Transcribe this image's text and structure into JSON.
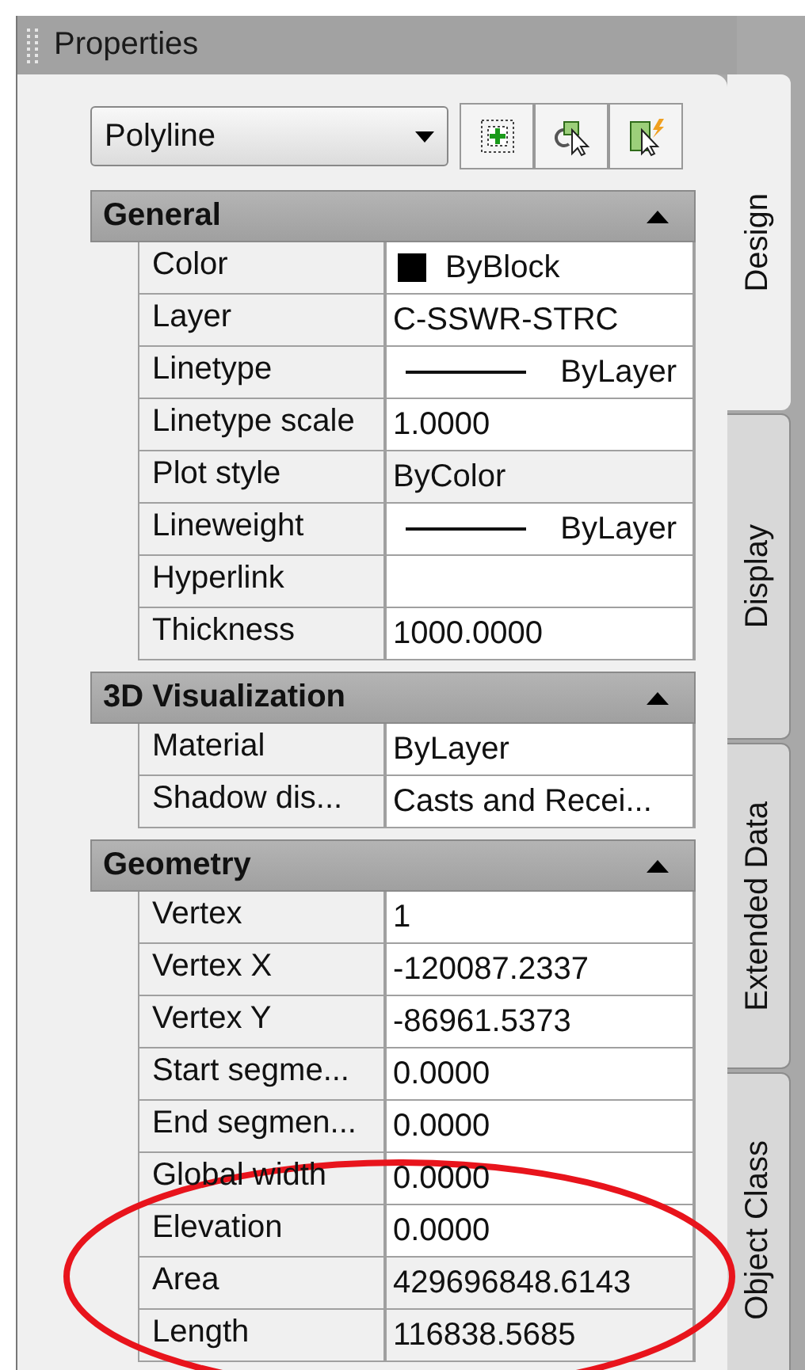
{
  "window": {
    "title": "Properties"
  },
  "object_type": {
    "value": "Polyline"
  },
  "toolbar": [
    {
      "kind": "add"
    },
    {
      "kind": "select"
    },
    {
      "kind": "quick"
    }
  ],
  "sections": [
    {
      "title": "General",
      "expanded": true,
      "rows": [
        {
          "label": "Color",
          "value": "ByBlock",
          "kind": "color",
          "color": "#000000",
          "readonly": false
        },
        {
          "label": "Layer",
          "value": "C-SSWR-STRC",
          "kind": "text",
          "readonly": false
        },
        {
          "label": "Linetype",
          "value": "ByLayer",
          "kind": "line",
          "readonly": false
        },
        {
          "label": "Linetype scale",
          "value": "1.0000",
          "kind": "text",
          "readonly": false
        },
        {
          "label": "Plot style",
          "value": "ByColor",
          "kind": "text",
          "readonly": true
        },
        {
          "label": "Lineweight",
          "value": "ByLayer",
          "kind": "line",
          "readonly": false
        },
        {
          "label": "Hyperlink",
          "kind": "text",
          "readonly": false
        },
        {
          "label": "Thickness",
          "value": "1000.0000",
          "kind": "text",
          "readonly": false
        }
      ]
    },
    {
      "title": "3D Visualization",
      "expanded": true,
      "rows": [
        {
          "label": "Material",
          "value": "ByLayer",
          "kind": "text",
          "readonly": false
        },
        {
          "label": "Shadow dis...",
          "value": "Casts and Recei...",
          "kind": "text",
          "readonly": false
        }
      ]
    },
    {
      "title": "Geometry",
      "expanded": true,
      "rows": [
        {
          "label": "Vertex",
          "value": "1",
          "kind": "text",
          "readonly": false
        },
        {
          "label": "Vertex X",
          "value": "-120087.2337",
          "kind": "text",
          "readonly": false
        },
        {
          "label": "Vertex Y",
          "value": "-86961.5373",
          "kind": "text",
          "readonly": false
        },
        {
          "label": "Start segme...",
          "value": "0.0000",
          "kind": "text",
          "readonly": false
        },
        {
          "label": "End segmen...",
          "value": "0.0000",
          "kind": "text",
          "readonly": false
        },
        {
          "label": "Global width",
          "value": "0.0000",
          "kind": "text",
          "readonly": false
        },
        {
          "label": "Elevation",
          "value": "0.0000",
          "kind": "text",
          "readonly": false
        },
        {
          "label": "Area",
          "value": "429696848.6143",
          "kind": "text",
          "readonly": true
        },
        {
          "label": "Length",
          "value": "116838.5685",
          "kind": "text",
          "readonly": true
        }
      ]
    }
  ],
  "tabs": [
    {
      "label": "Design",
      "selected": true
    },
    {
      "label": "Display",
      "selected": false
    },
    {
      "label": "Extended Data",
      "selected": false
    },
    {
      "label": "Object Class",
      "selected": false
    }
  ],
  "annotation": {
    "kind": "ellipse"
  }
}
